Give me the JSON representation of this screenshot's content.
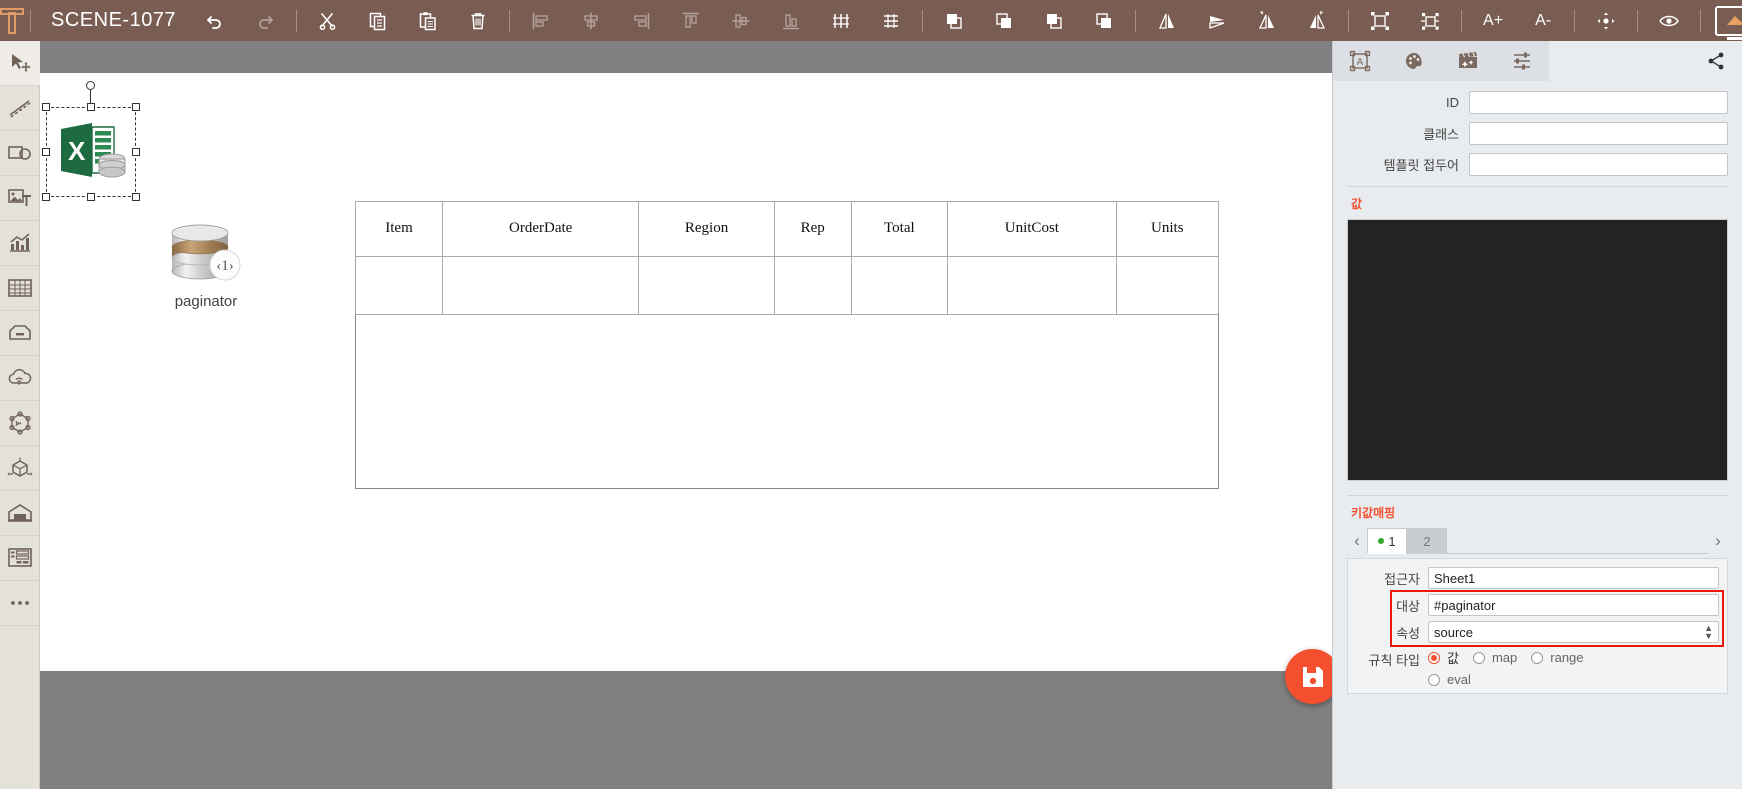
{
  "topbar": {
    "logo": "logo-t-icon",
    "scene_title": "SCENE-1077",
    "tools": [
      {
        "name": "undo-icon",
        "label": "Undo",
        "enabled": true
      },
      {
        "name": "redo-icon",
        "label": "Redo",
        "enabled": false
      },
      {
        "name": "cut-icon",
        "label": "Cut",
        "enabled": true
      },
      {
        "name": "copy-icon",
        "label": "Copy",
        "enabled": true
      },
      {
        "name": "paste-icon",
        "label": "Paste",
        "enabled": true
      },
      {
        "name": "delete-icon",
        "label": "Delete",
        "enabled": true
      },
      {
        "name": "align-left-icon",
        "label": "Align left",
        "enabled": false
      },
      {
        "name": "align-center-horizontal-icon",
        "label": "Align center",
        "enabled": false
      },
      {
        "name": "align-right-icon",
        "label": "Align right",
        "enabled": false
      },
      {
        "name": "align-top-icon",
        "label": "Align top",
        "enabled": false
      },
      {
        "name": "align-middle-icon",
        "label": "Align middle",
        "enabled": false
      },
      {
        "name": "align-bottom-icon",
        "label": "Align bottom",
        "enabled": false
      },
      {
        "name": "distribute-horizontal-icon",
        "label": "Distribute horizontally",
        "enabled": true
      },
      {
        "name": "distribute-vertical-icon",
        "label": "Distribute vertically",
        "enabled": true
      },
      {
        "name": "bring-to-front-icon",
        "label": "Bring to front",
        "enabled": true
      },
      {
        "name": "bring-forward-icon",
        "label": "Bring forward",
        "enabled": true
      },
      {
        "name": "send-backward-icon",
        "label": "Send backward",
        "enabled": true
      },
      {
        "name": "send-to-back-icon",
        "label": "Send to back",
        "enabled": true
      },
      {
        "name": "flip-horizontal-icon",
        "label": "Flip horizontal",
        "enabled": true
      },
      {
        "name": "flip-vertical-icon",
        "label": "Flip vertical",
        "enabled": true
      },
      {
        "name": "rotate-left-icon",
        "label": "Rotate left",
        "enabled": true
      },
      {
        "name": "rotate-right-icon",
        "label": "Rotate right",
        "enabled": true
      },
      {
        "name": "group-icon",
        "label": "Group",
        "enabled": true
      },
      {
        "name": "ungroup-icon",
        "label": "Ungroup",
        "enabled": true
      },
      {
        "name": "font-increase-icon",
        "label": "A+",
        "enabled": true
      },
      {
        "name": "font-decrease-icon",
        "label": "A-",
        "enabled": true
      },
      {
        "name": "move-icon",
        "label": "Move",
        "enabled": true
      },
      {
        "name": "preview-eye-icon",
        "label": "Preview",
        "enabled": true
      }
    ],
    "font_increase_label": "A+",
    "font_decrease_label": "A-",
    "screen_button": "screen-icon",
    "panel_toggle": "panel-collapse-icon"
  },
  "left_rail": {
    "items": [
      {
        "name": "select-move-tool",
        "icon": "cursor-move-icon",
        "label": "Select / Move",
        "active": true
      },
      {
        "name": "line-tool",
        "icon": "dashed-line-icon",
        "label": "Line"
      },
      {
        "name": "shape-tool",
        "icon": "rect-circle-icon",
        "label": "Shapes"
      },
      {
        "name": "image-text-tool",
        "icon": "image-text-icon",
        "label": "Image & Text"
      },
      {
        "name": "chart-tool",
        "icon": "chart-icon",
        "label": "Chart"
      },
      {
        "name": "table-tool",
        "icon": "table-grid-icon",
        "label": "Table"
      },
      {
        "name": "box-tool",
        "icon": "box-icon",
        "label": "Box"
      },
      {
        "name": "cloud-tool",
        "icon": "cloud-wifi-icon",
        "label": "Cloud"
      },
      {
        "name": "network-tool",
        "icon": "network-node-icon",
        "label": "Network"
      },
      {
        "name": "asset-3d-tool",
        "icon": "cube-3d-icon",
        "label": "3D Asset"
      },
      {
        "name": "facility-tool",
        "icon": "warehouse-icon",
        "label": "Facility"
      },
      {
        "name": "widget-tool",
        "icon": "widget-panel-icon",
        "label": "Widget"
      },
      {
        "name": "more-tool",
        "icon": "more-dots-icon",
        "label": "More"
      }
    ]
  },
  "canvas": {
    "excel_object": {
      "name": "excel-data-source-object",
      "selected": true,
      "icon": "excel-database-icon"
    },
    "paginator_object": {
      "name": "paginator-object",
      "label": "paginator",
      "icon": "database-paginator-icon",
      "page_indicator": "1",
      "prev_glyph": "‹",
      "next_glyph": "›"
    },
    "table": {
      "headers": [
        "Item",
        "OrderDate",
        "Region",
        "Rep",
        "Total",
        "UnitCost",
        "Units"
      ],
      "rows": [
        [
          "",
          "",
          "",
          "",
          "",
          "",
          ""
        ]
      ]
    },
    "save_button": {
      "name": "save-button",
      "icon": "floppy-save-icon",
      "color": "#f4502f"
    }
  },
  "right_panel": {
    "tabs": [
      {
        "name": "tab-properties",
        "icon": "text-frame-icon",
        "selected": true
      },
      {
        "name": "tab-style",
        "icon": "palette-icon",
        "selected": false
      },
      {
        "name": "tab-animation",
        "icon": "clapperboard-icon",
        "selected": false
      },
      {
        "name": "tab-settings",
        "icon": "sliders-icon",
        "selected": false
      }
    ],
    "share": {
      "name": "share-icon",
      "label": "Share"
    },
    "fields": [
      {
        "name": "id-field",
        "label": "ID",
        "value": "",
        "placeholder": ""
      },
      {
        "name": "class-field",
        "label": "클래스",
        "value": "",
        "placeholder": ""
      },
      {
        "name": "template-prefix-field",
        "label": "템플릿 접두어",
        "value": "",
        "placeholder": ""
      }
    ],
    "value_section": {
      "title": "값",
      "editor_content": "",
      "editor_bg": "#232321"
    },
    "keymap_section": {
      "title": "키값매핑",
      "prev_arrow": "‹",
      "next_arrow": "›",
      "tabs": [
        {
          "label": "1",
          "selected": true,
          "has_dot": true
        },
        {
          "label": "2",
          "selected": false,
          "has_dot": false
        }
      ],
      "accessor": {
        "label": "접근자",
        "value": "Sheet1"
      },
      "target": {
        "label": "대상",
        "value": "#paginator"
      },
      "attribute": {
        "label": "속성",
        "value": "source"
      },
      "rule_type": {
        "label": "규칙 타입",
        "options": [
          {
            "label": "값",
            "selected": true
          },
          {
            "label": "map",
            "selected": false
          },
          {
            "label": "range",
            "selected": false
          },
          {
            "label": "eval",
            "selected": false
          }
        ]
      },
      "highlight_color": "#e8180c"
    }
  }
}
